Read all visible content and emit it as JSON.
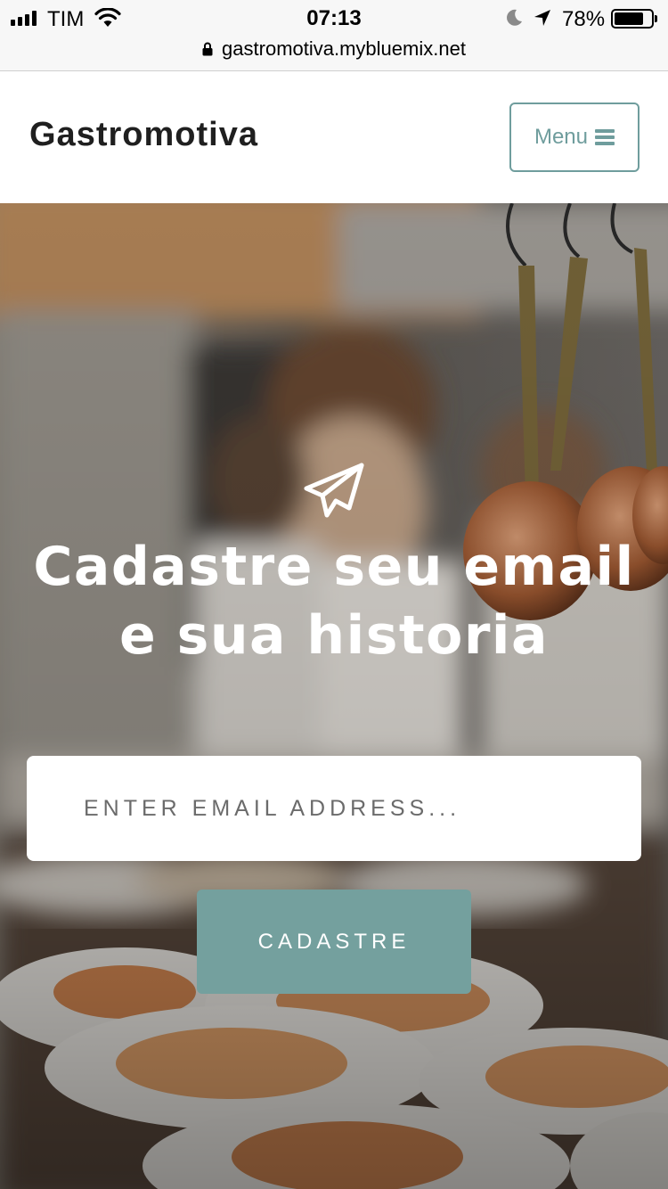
{
  "status_bar": {
    "carrier": "TIM",
    "time": "07:13",
    "battery_percent": "78%",
    "url": "gastromotiva.mybluemix.net"
  },
  "navbar": {
    "brand": "Gastromotiva",
    "menu_label": "Menu"
  },
  "hero": {
    "icon": "paper-plane-icon",
    "headline": "Cadastre seu email e sua historia",
    "email_placeholder": "ENTER EMAIL ADDRESS...",
    "submit_label": "CADASTRE"
  },
  "colors": {
    "accent": "#74a09e",
    "menu_border": "#6f9d9d"
  }
}
